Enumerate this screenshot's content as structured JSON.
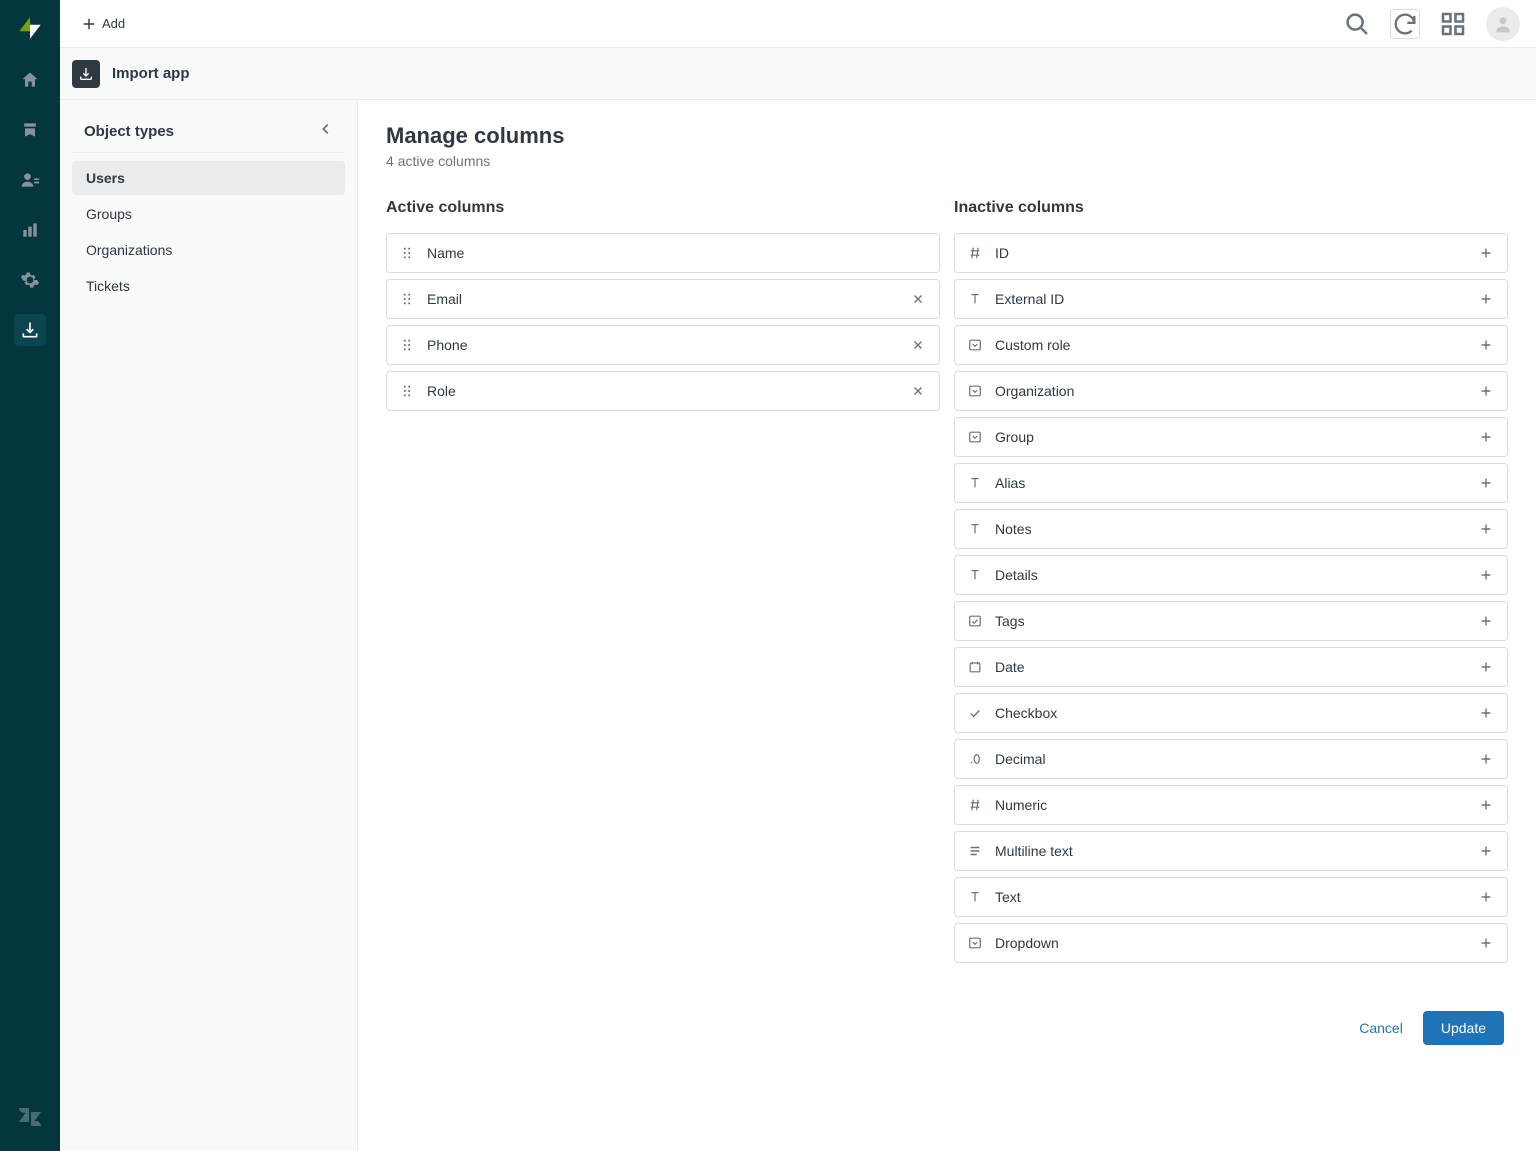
{
  "topbar": {
    "add_label": "Add"
  },
  "app_header": {
    "title": "Import app"
  },
  "sidebar": {
    "section_title": "Object types",
    "items": [
      {
        "label": "Users",
        "selected": true
      },
      {
        "label": "Groups",
        "selected": false
      },
      {
        "label": "Organizations",
        "selected": false
      },
      {
        "label": "Tickets",
        "selected": false
      }
    ]
  },
  "panel": {
    "title": "Manage columns",
    "subtitle": "4 active columns",
    "active_heading": "Active columns",
    "inactive_heading": "Inactive columns",
    "active_columns": [
      {
        "label": "Name",
        "removable": false
      },
      {
        "label": "Email",
        "removable": true
      },
      {
        "label": "Phone",
        "removable": true
      },
      {
        "label": "Role",
        "removable": true
      }
    ],
    "inactive_columns": [
      {
        "label": "ID",
        "icon": "hash"
      },
      {
        "label": "External ID",
        "icon": "text"
      },
      {
        "label": "Custom role",
        "icon": "dropdown"
      },
      {
        "label": "Organization",
        "icon": "dropdown"
      },
      {
        "label": "Group",
        "icon": "dropdown"
      },
      {
        "label": "Alias",
        "icon": "text"
      },
      {
        "label": "Notes",
        "icon": "text"
      },
      {
        "label": "Details",
        "icon": "text"
      },
      {
        "label": "Tags",
        "icon": "tags"
      },
      {
        "label": "Date",
        "icon": "date"
      },
      {
        "label": "Checkbox",
        "icon": "check"
      },
      {
        "label": "Decimal",
        "icon": "decimal"
      },
      {
        "label": "Numeric",
        "icon": "hash"
      },
      {
        "label": "Multiline text",
        "icon": "multiline"
      },
      {
        "label": "Text",
        "icon": "text"
      },
      {
        "label": "Dropdown",
        "icon": "dropdown"
      }
    ],
    "cancel_label": "Cancel",
    "update_label": "Update"
  }
}
